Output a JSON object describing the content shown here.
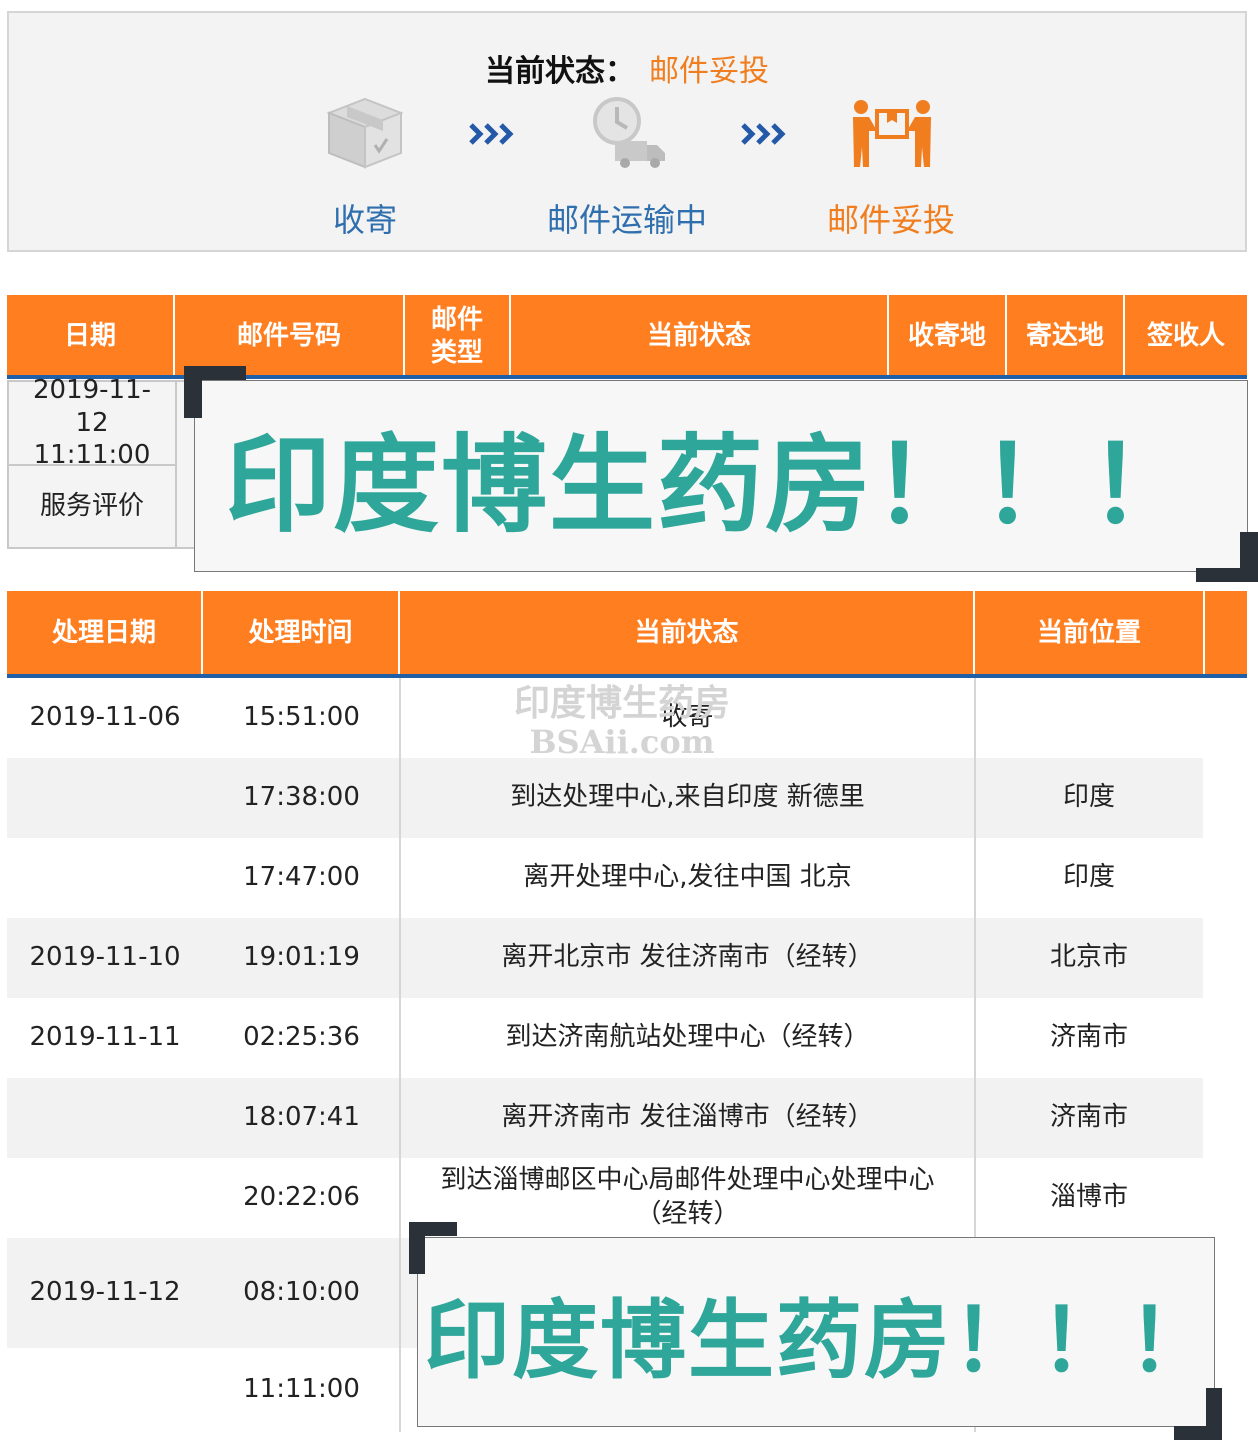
{
  "status": {
    "label": "当前状态：",
    "value": "邮件妥投",
    "steps": [
      {
        "label": "收寄",
        "icon": "box-icon"
      },
      {
        "label": "邮件运输中",
        "icon": "delivery-truck-icon"
      },
      {
        "label": "邮件妥投",
        "icon": "handover-icon"
      }
    ],
    "colors": {
      "active": "#f07d1e",
      "inactive": "#2f6fae",
      "arrow": "#2459a8"
    }
  },
  "parcel_table": {
    "headers": [
      "日期",
      "邮件号码",
      "邮件类型",
      "当前状态",
      "收寄地",
      "寄达地",
      "签收人"
    ],
    "date_value": "2019-11-12 11:11:00",
    "service_label": "服务评价"
  },
  "tracking_table": {
    "headers": [
      "处理日期",
      "处理时间",
      "当前状态",
      "当前位置"
    ],
    "rows": [
      {
        "date": "2019-11-06",
        "time": "15:51:00",
        "status": "收寄",
        "location": ""
      },
      {
        "date": "",
        "time": "17:38:00",
        "status": "到达处理中心,来自印度 新德里",
        "location": "印度"
      },
      {
        "date": "",
        "time": "17:47:00",
        "status": "离开处理中心,发往中国 北京",
        "location": "印度"
      },
      {
        "date": "2019-11-10",
        "time": "19:01:19",
        "status": "离开北京市 发往济南市（经转）",
        "location": "北京市"
      },
      {
        "date": "2019-11-11",
        "time": "02:25:36",
        "status": "到达济南航站处理中心（经转）",
        "location": "济南市"
      },
      {
        "date": "",
        "time": "18:07:41",
        "status": "离开济南市 发往淄博市（经转）",
        "location": "济南市"
      },
      {
        "date": "",
        "time": "20:22:06",
        "status": "到达淄博邮区中心局邮件处理中心处理中心（经转）",
        "location": "淄博市"
      },
      {
        "date": "2019-11-12",
        "time": "08:10:00",
        "status": "",
        "location": ""
      },
      {
        "date": "",
        "time": "11:11:00",
        "status": "",
        "location": ""
      }
    ]
  },
  "overlays": {
    "ad_text": "印度博生药房！！！",
    "watermark_line1": "印度博生药房",
    "watermark_line2": "BSAii.com",
    "colors": {
      "ad_text": "#2fa69a",
      "header": "#ff7e1f",
      "header_rule": "#1f5fa8"
    }
  }
}
